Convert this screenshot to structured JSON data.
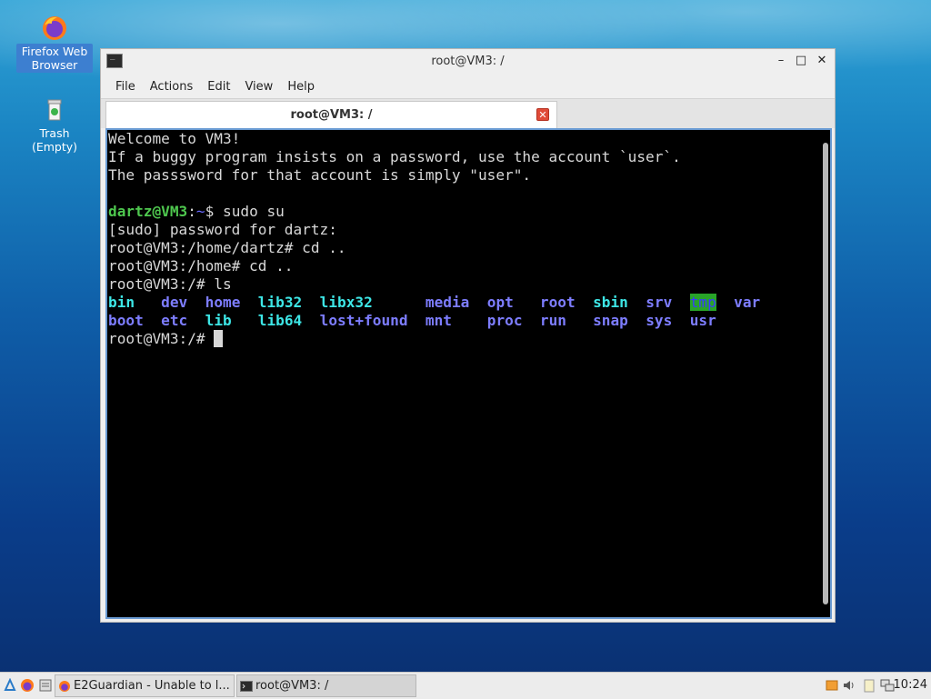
{
  "desktop": {
    "icons": [
      {
        "label": "Firefox Web Browser",
        "icon": "firefox-icon"
      },
      {
        "label": "Trash (Empty)",
        "icon": "trash-icon"
      }
    ]
  },
  "window": {
    "title": "root@VM3: /",
    "menu": [
      "File",
      "Actions",
      "Edit",
      "View",
      "Help"
    ],
    "tab_title": "root@VM3: /"
  },
  "terminal": {
    "lines": [
      "Welcome to VM3!",
      "If a buggy program insists on a password, use the account `user`.",
      "The passsword for that account is simply \"user\".",
      "",
      "dartz@VM3:~$ sudo su",
      "[sudo] password for dartz:",
      "root@VM3:/home/dartz# cd ..",
      "root@VM3:/home# cd ..",
      "root@VM3:/# ls",
      "bin   dev  home  lib32  libx32      media  opt   root  sbin  srv  tmp  var",
      "boot  etc  lib   lib64  lost+found  mnt    proc  run   snap  sys  usr",
      "root@VM3:/# "
    ],
    "prompt_user": "dartz@VM3",
    "prompt_path": "~",
    "ls_row1": [
      "bin",
      "dev",
      "home",
      "lib32",
      "libx32",
      "media",
      "opt",
      "root",
      "sbin",
      "srv",
      "tmp",
      "var"
    ],
    "ls_row2": [
      "boot",
      "etc",
      "lib",
      "lib64",
      "lost+found",
      "mnt",
      "proc",
      "run",
      "snap",
      "sys",
      "usr"
    ]
  },
  "taskbar": {
    "tasks": [
      "E2Guardian - Unable to l...",
      "root@VM3: /"
    ],
    "clock": "10:24"
  },
  "colors": {
    "prompt_green": "#4ec74e",
    "path_blue": "#6a6aff",
    "link_cyan": "#3de6e6",
    "tmp_bg": "#28a428"
  }
}
